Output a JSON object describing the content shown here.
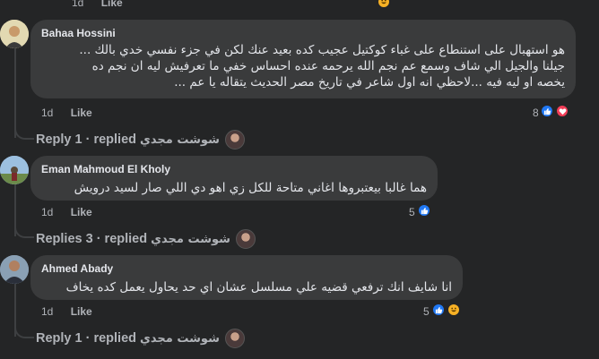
{
  "top": {
    "time": "1d",
    "like": "Like"
  },
  "comments": [
    {
      "author": "Bahaa Hossini",
      "lines": [
        "هو استهبال على استنطاع على غباء كوكتيل عجيب كده بعيد عنك لكن في جزء نفسي خدي بالك ...",
        "جيلنا والجيل الي شاف وسمع عم نجم الله يرحمه عنده احساس خفي ما تعرفيش ليه ان نجم ده",
        "يخصه او ليه فيه ...لاحظي انه اول شاعر في تاريخ مصر الحديث يتقاله يا عم ..."
      ],
      "time": "1d",
      "like": "Like",
      "reaction_count": "8",
      "reactions": [
        "like-icon",
        "love-icon"
      ],
      "reply_label": "Reply",
      "reply_count": "1",
      "replied_label": "replied",
      "replier": "شوشت مجدي"
    },
    {
      "author": "Eman Mahmoud El Kholy",
      "lines": [
        "هما غالبا بيعتبروها اغاني متاحة للكل زي اهو دي اللي صار لسيد درويش"
      ],
      "time": "1d",
      "like": "Like",
      "reaction_count": "5",
      "reactions": [
        "like-icon"
      ],
      "reply_label": "Replies",
      "reply_count": "3",
      "replied_label": "replied",
      "replier": "شوشت مجدي"
    },
    {
      "author": "Ahmed Abady",
      "lines": [
        "انا شايف انك ترفعي قضيه علي مسلسل عشان اي حد يحاول يعمل كده يخاف"
      ],
      "time": "1d",
      "like": "Like",
      "reaction_count": "5",
      "reactions": [
        "like-icon",
        "haha-icon"
      ],
      "reply_label": "Reply",
      "reply_count": "1",
      "replied_label": "replied",
      "replier": "شوشت مجدي"
    }
  ],
  "colors": {
    "like": "#2078f4",
    "love": "#f33e58",
    "haha": "#f7b125"
  }
}
